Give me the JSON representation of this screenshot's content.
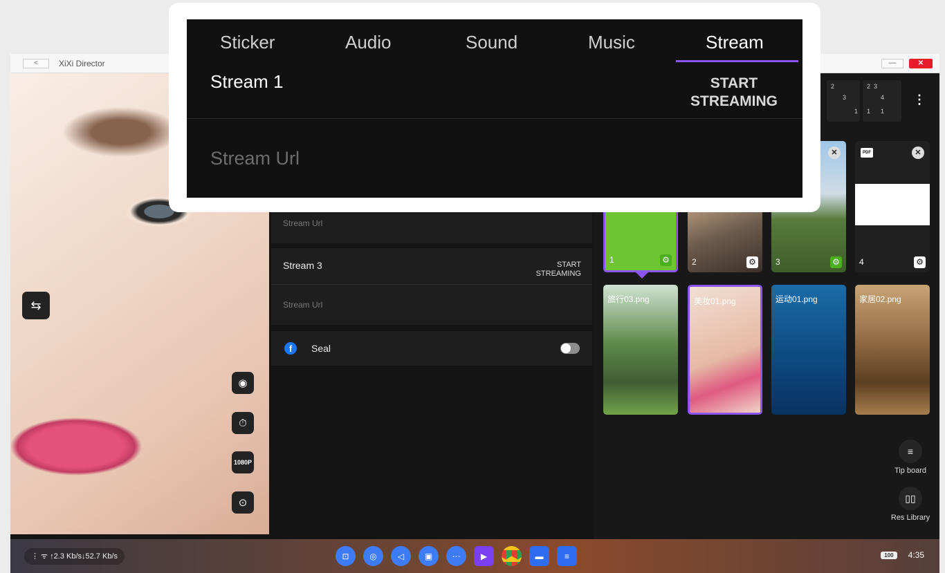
{
  "window": {
    "back": "<",
    "title": "XiXi Director",
    "min": "—",
    "close": "✕"
  },
  "preview": {
    "buttons": [
      {
        "name": "swap-icon",
        "glyph": "⇆"
      },
      {
        "name": "beauty-icon",
        "glyph": "◉"
      },
      {
        "name": "timer-icon",
        "glyph": "⏱"
      },
      {
        "name": "resolution",
        "glyph": "1080P"
      },
      {
        "name": "record-icon",
        "glyph": "⊙"
      }
    ]
  },
  "streams": {
    "stream2": {
      "url_placeholder": "Stream Url"
    },
    "stream3": {
      "label": "Stream 3",
      "start": "START\nSTREAMING",
      "url_placeholder": "Stream Url"
    },
    "seal": {
      "label": "Seal",
      "icon": "facebook-icon",
      "enabled": false
    }
  },
  "scenes": {
    "selectors": [
      {
        "top": "2",
        "mid": "3",
        "bottom": "1"
      },
      {
        "top": "2  3",
        "mid": "4",
        "bottom": "1      1"
      }
    ],
    "more": "⋮"
  },
  "tiles_row1": [
    {
      "num": "1",
      "color": "#6ec531"
    },
    {
      "num": "2"
    },
    {
      "num": "3"
    },
    {
      "num": "4"
    }
  ],
  "tiles_row2": [
    {
      "caption": "旅行03.png"
    },
    {
      "caption": "美妆01.png"
    },
    {
      "caption": "运动01.png"
    },
    {
      "caption": "家居02.png"
    }
  ],
  "side_buttons": {
    "tipboard": "Tip board",
    "reslib": "Res Library"
  },
  "taskbar": {
    "net": "↑2.3 Kb/s↓52.7 Kb/s",
    "battery": "100",
    "time": "4:35"
  },
  "popup": {
    "tabs": [
      "Sticker",
      "Audio",
      "Sound",
      "Music",
      "Stream"
    ],
    "active_tab": "Stream",
    "label": "Stream 1",
    "start": "START\nSTREAMING",
    "url_placeholder": "Stream Url"
  },
  "colors": {
    "accent": "#8a55f0",
    "scene_active": "#6ec531",
    "close": "#e81b2b"
  }
}
